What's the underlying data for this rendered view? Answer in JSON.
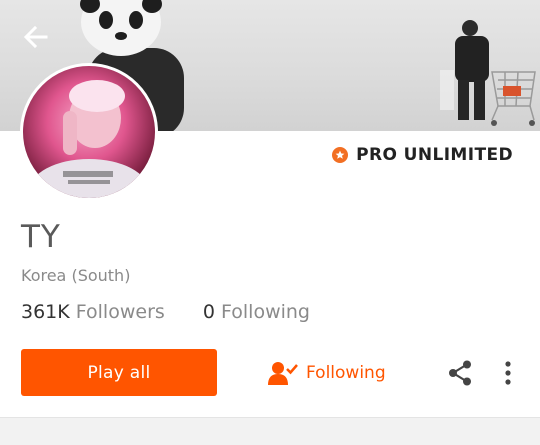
{
  "banner": {
    "back_icon": "arrow-left-icon"
  },
  "profile": {
    "name": "TY",
    "location": "Korea (South)",
    "badge": "PRO UNLIMITED",
    "badge_icon": "star-badge-icon",
    "followers_count": "361K",
    "followers_label": "Followers",
    "following_count": "0",
    "following_label": "Following"
  },
  "actions": {
    "play_all_label": "Play all",
    "following_label": "Following",
    "following_icon": "user-check-icon",
    "share_icon": "share-icon",
    "more_icon": "more-vertical-icon"
  },
  "colors": {
    "accent": "#ff5500",
    "badge": "#f26f23"
  }
}
